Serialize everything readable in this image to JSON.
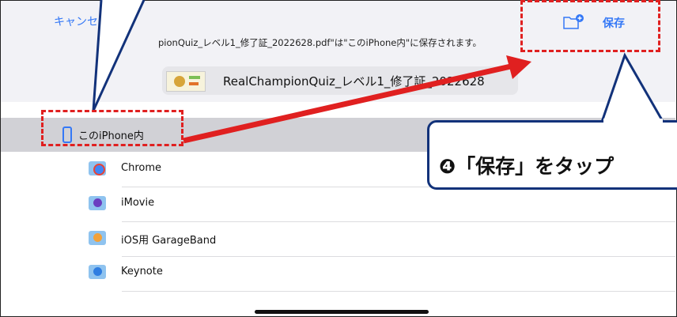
{
  "header": {
    "cancel_label": "キャンセ",
    "save_label": "保存",
    "save_hint": "pionQuiz_レベル1_修了証_2022628.pdf\"は\"このiPhone内\"に保存されます。",
    "file_name": "RealChampionQuiz_レベル1_修了証_2022628"
  },
  "location": {
    "label": "このiPhone内"
  },
  "apps": [
    {
      "label": "Chrome",
      "icon": "chrome-icon"
    },
    {
      "label": "iMovie",
      "icon": "imovie-icon"
    },
    {
      "label": "iOS用 GarageBand",
      "icon": "garageband-icon"
    },
    {
      "label": "Keynote",
      "icon": "keynote-icon"
    }
  ],
  "annotation": {
    "callout_text": "❹「保存」をタップ"
  },
  "colors": {
    "ios_blue": "#3478f6",
    "highlight_red": "#e02020",
    "callout_border": "#12327a"
  }
}
